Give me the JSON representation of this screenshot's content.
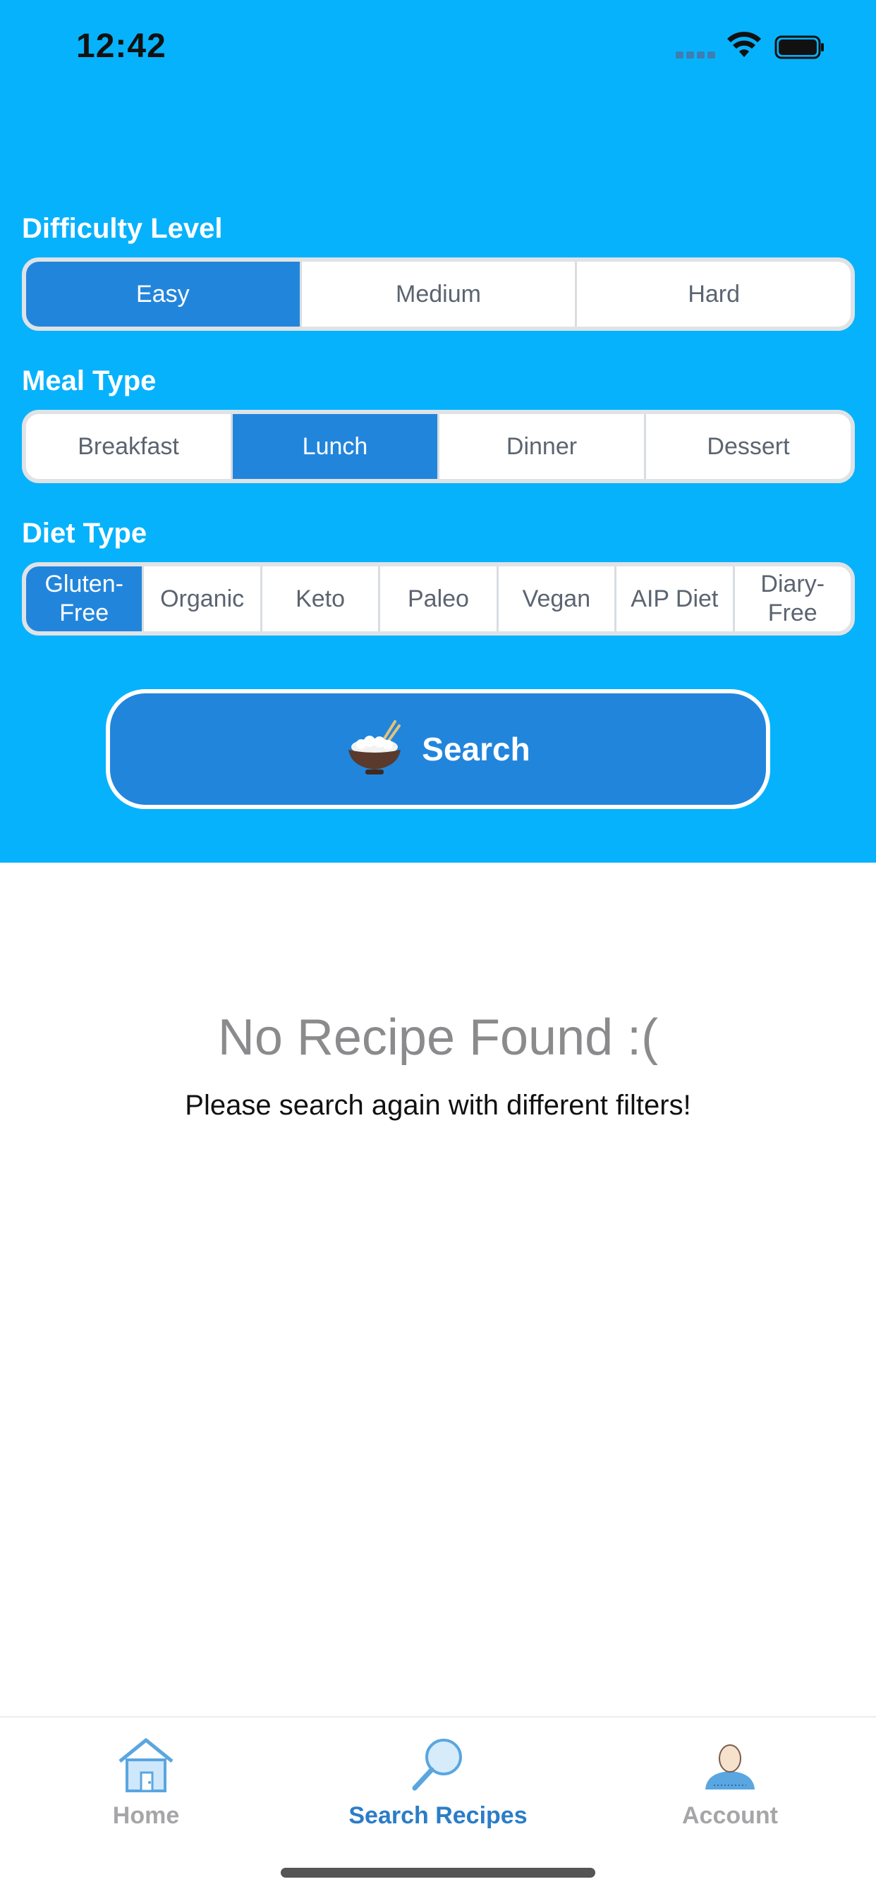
{
  "status_bar": {
    "time": "12:42"
  },
  "filters": {
    "difficulty": {
      "label": "Difficulty Level",
      "options": [
        "Easy",
        "Medium",
        "Hard"
      ],
      "selected": "Easy"
    },
    "meal_type": {
      "label": "Meal Type",
      "options": [
        "Breakfast",
        "Lunch",
        "Dinner",
        "Dessert"
      ],
      "selected": "Lunch"
    },
    "diet_type": {
      "label": "Diet Type",
      "options": [
        "Gluten-Free",
        "Organic",
        "Keto",
        "Paleo",
        "Vegan",
        "AIP Diet",
        "Diary-Free"
      ],
      "selected": "Gluten-Free"
    }
  },
  "search_button": {
    "label": "Search",
    "icon": "rice-bowl-icon"
  },
  "empty_state": {
    "title": "No Recipe Found :(",
    "subtitle": "Please search again with different filters!"
  },
  "tabbar": {
    "items": [
      {
        "label": "Home",
        "icon": "home-icon",
        "active": false
      },
      {
        "label": "Search Recipes",
        "icon": "magnifier-icon",
        "active": true
      },
      {
        "label": "Account",
        "icon": "user-icon",
        "active": false
      }
    ]
  },
  "colors": {
    "header_background": "#07b2fc",
    "accent": "#2285dc",
    "tab_active": "#2b7dc8",
    "tab_inactive": "#a6a6a8"
  }
}
